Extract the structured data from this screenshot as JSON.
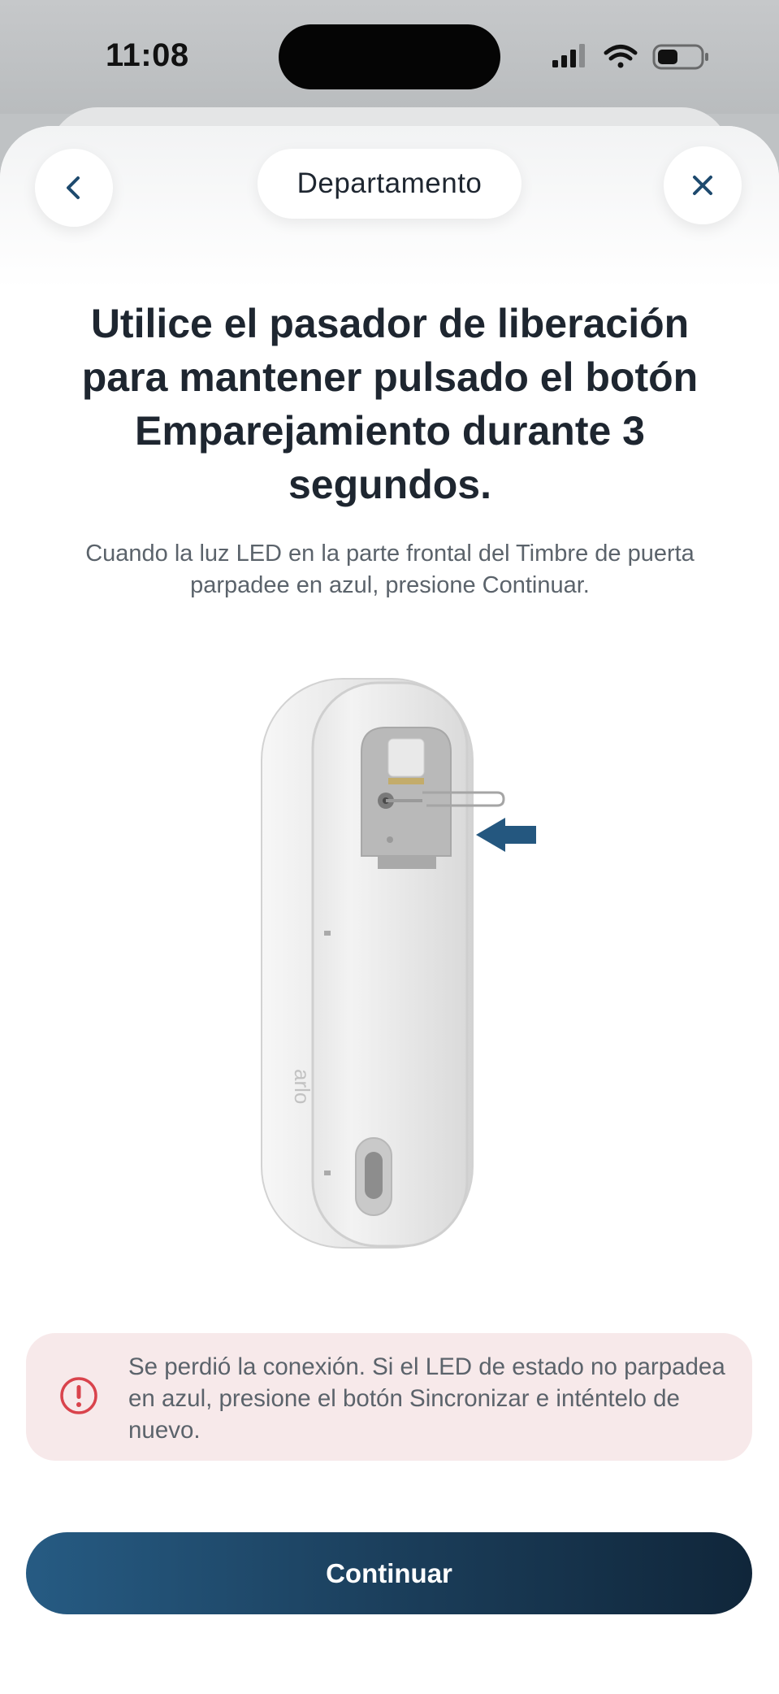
{
  "status_bar": {
    "time": "11:08"
  },
  "header": {
    "title": "Departamento"
  },
  "main": {
    "heading": "Utilice el pasador de liberación para mantener pulsado el botón Emparejamiento durante 3 segundos.",
    "description": "Cuando la luz LED en la parte frontal del Timbre de puerta parpadee en azul, presione Continuar.",
    "device_brand": "arlo"
  },
  "alert": {
    "message": "Se perdió la conexión. Si el LED de estado no parpadea en azul, presione el botón Sincronizar e inténtelo de nuevo."
  },
  "footer": {
    "continue_label": "Continuar"
  },
  "colors": {
    "primary": "#1e4a6e",
    "text_dark": "#1e2630",
    "text_muted": "#5b636b",
    "alert_bg": "#f7e9ea",
    "alert_icon": "#d9434c",
    "arrow": "#24577f"
  },
  "icons": [
    "signal-icon",
    "wifi-icon",
    "battery-icon",
    "chevron-left-icon",
    "close-icon",
    "alert-circle-icon",
    "arrow-left-icon"
  ]
}
